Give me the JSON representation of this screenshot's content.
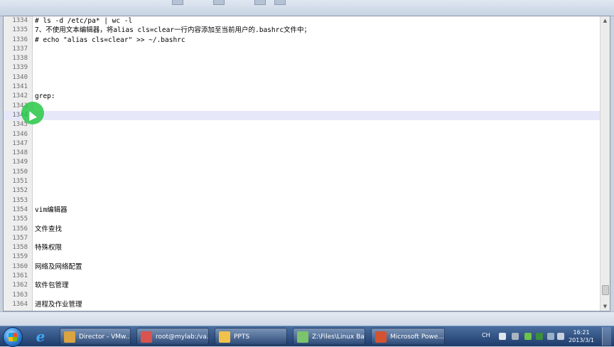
{
  "editor": {
    "lines": [
      {
        "num": "1334",
        "text": "# ls -d /etc/pa* | wc -l"
      },
      {
        "num": "1335",
        "text": "7、不使用文本编辑器，将alias cls=clear一行内容添加至当前用户的.bashrc文件中；"
      },
      {
        "num": "1336",
        "text": "# echo \"alias cls=clear\" >> ~/.bashrc"
      },
      {
        "num": "1337",
        "text": ""
      },
      {
        "num": "1338",
        "text": ""
      },
      {
        "num": "1339",
        "text": ""
      },
      {
        "num": "1340",
        "text": ""
      },
      {
        "num": "1341",
        "text": ""
      },
      {
        "num": "1342",
        "text": "grep:"
      },
      {
        "num": "1343",
        "text": ""
      },
      {
        "num": "1344",
        "text": "",
        "current": true
      },
      {
        "num": "1345",
        "text": ""
      },
      {
        "num": "1346",
        "text": ""
      },
      {
        "num": "1347",
        "text": ""
      },
      {
        "num": "1348",
        "text": ""
      },
      {
        "num": "1349",
        "text": ""
      },
      {
        "num": "1350",
        "text": ""
      },
      {
        "num": "1351",
        "text": ""
      },
      {
        "num": "1352",
        "text": ""
      },
      {
        "num": "1353",
        "text": ""
      },
      {
        "num": "1354",
        "text": "vim编辑器"
      },
      {
        "num": "1355",
        "text": ""
      },
      {
        "num": "1356",
        "text": "文件查找"
      },
      {
        "num": "1357",
        "text": ""
      },
      {
        "num": "1358",
        "text": "特殊权限"
      },
      {
        "num": "1359",
        "text": ""
      },
      {
        "num": "1360",
        "text": "网络及网络配置"
      },
      {
        "num": "1361",
        "text": ""
      },
      {
        "num": "1362",
        "text": "软件包管理"
      },
      {
        "num": "1363",
        "text": ""
      },
      {
        "num": "1364",
        "text": "进程及作业管理"
      }
    ],
    "current_line_color": "#e6e8fa"
  },
  "taskbar": {
    "buttons": [
      {
        "label": "Director - VMw...",
        "icon": "vmware-icon",
        "color": "#d9a441"
      },
      {
        "label": "root@mylab:/va...",
        "icon": "terminal-icon",
        "color": "#d9534f"
      },
      {
        "label": "PPTS",
        "icon": "folder-icon",
        "color": "#f0c24b"
      },
      {
        "label": "Z:\\Files\\Linux Ba...",
        "icon": "notepad-icon",
        "color": "#7cc46b"
      },
      {
        "label": "Microsoft Powe...",
        "icon": "powerpoint-icon",
        "color": "#d35230"
      }
    ],
    "tray": {
      "language": "CH",
      "time": "16:21",
      "date": "2013/3/1"
    }
  },
  "colors": {
    "taskbar": "#1d3b6b",
    "cursor_highlight": "#28c846"
  }
}
